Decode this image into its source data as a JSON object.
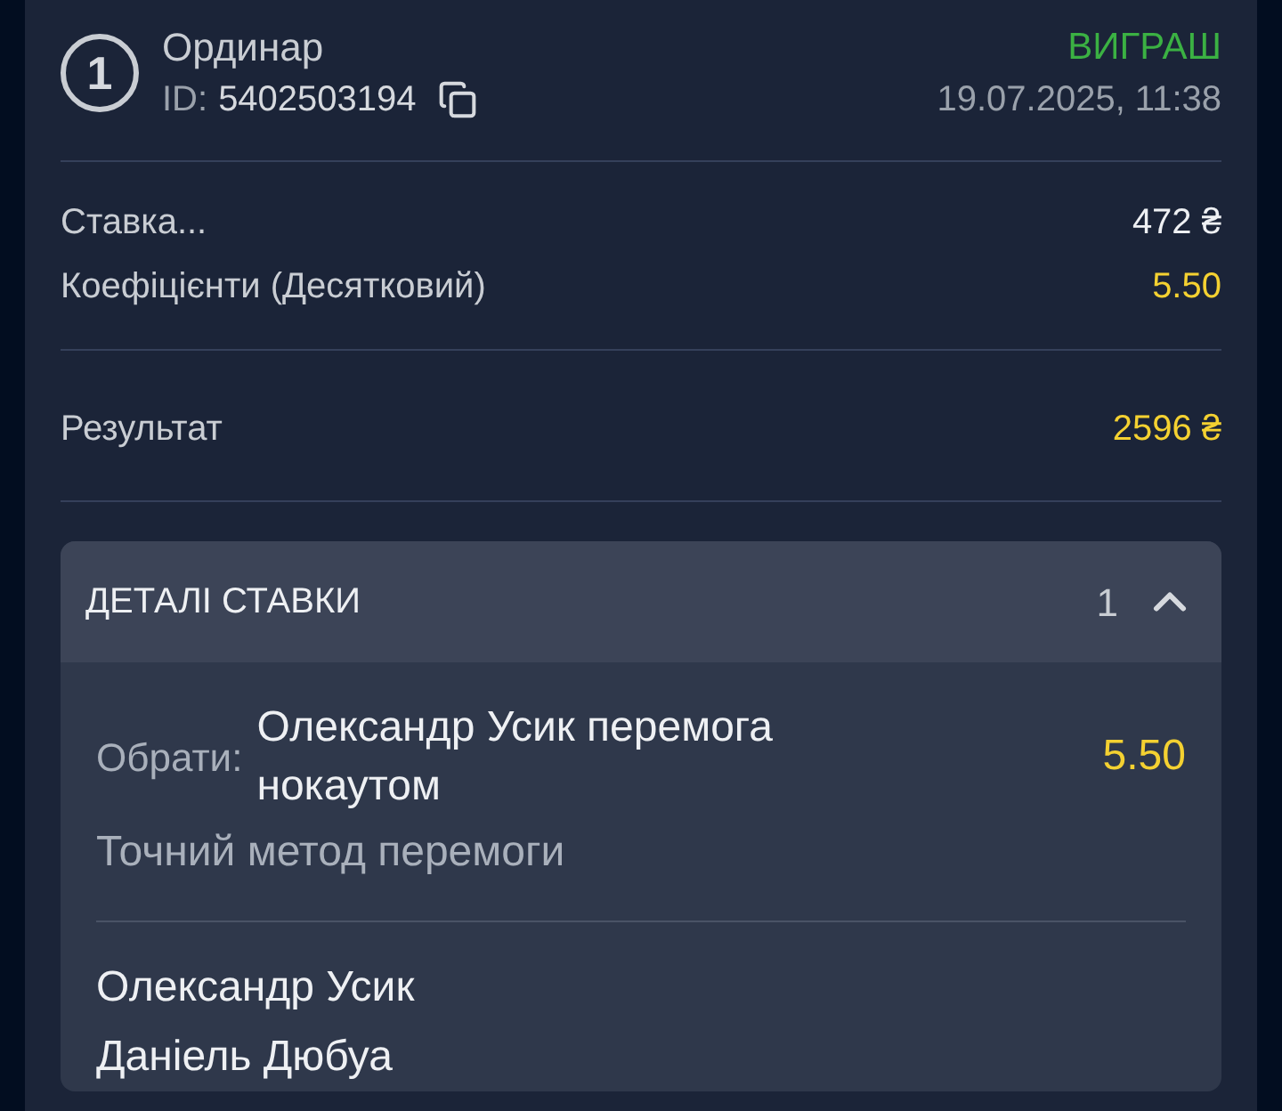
{
  "bet": {
    "number": "1",
    "type": "Ординар",
    "id_label": "ID:",
    "id": "5402503194",
    "status": "ВИГРАШ",
    "won": true,
    "datetime": "19.07.2025, 11:38"
  },
  "summary": [
    {
      "label": "Ставка...",
      "value": "472 ₴",
      "highlight": false
    },
    {
      "label": "Коефіцієнти (Десятковий)",
      "value": "5.50",
      "highlight": true
    }
  ],
  "result": {
    "label": "Результат",
    "value": "2596 ₴"
  },
  "details": {
    "title": "ДЕТАЛІ СТАВКИ",
    "count": "1",
    "expanded": true,
    "selections": [
      {
        "pick_label": "Обрати:",
        "pick": "Олександр Усик перемога нокаутом",
        "odds": "5.50",
        "market": "Точний метод перемоги",
        "participants": [
          "Олександр Усик",
          "Даніель Дюбуа"
        ]
      }
    ]
  }
}
